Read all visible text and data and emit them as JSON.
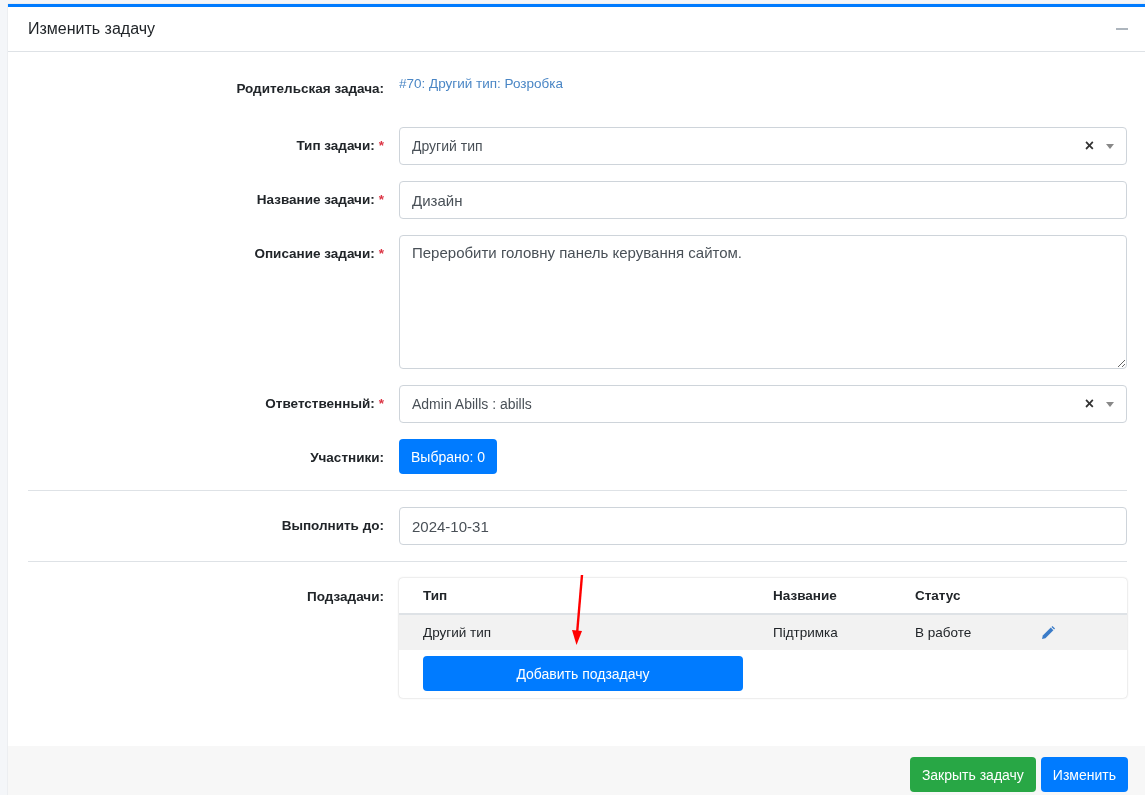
{
  "card": {
    "title": "Изменить задачу"
  },
  "form": {
    "parent": {
      "label": "Родительская задача:",
      "link": "#70: Другий тип: Розробка"
    },
    "fields": [
      {
        "kind": "select",
        "label": "Тип задачи:",
        "required_mark": "*",
        "value": "Другий тип",
        "clear": "×"
      },
      {
        "kind": "text",
        "label": "Название задачи:",
        "required_mark": "*",
        "value": "Дизайн"
      },
      {
        "kind": "textarea",
        "label": "Описание задачи:",
        "required_mark": "*",
        "value": "Переробити головну панель керування сайтом."
      },
      {
        "kind": "select",
        "label": "Ответственный:",
        "required_mark": "*",
        "value": "Admin Abills : abills",
        "clear": "×"
      },
      {
        "kind": "button",
        "label": "Участники:",
        "value": "Выбрано: 0"
      },
      {
        "kind": "divider"
      },
      {
        "kind": "text",
        "label": "Выполнить до:",
        "value": "2024-10-31"
      },
      {
        "kind": "divider"
      }
    ],
    "subtasks": {
      "label": "Подзадачи:",
      "columns": [
        "Тип",
        "Название",
        "Статус"
      ],
      "rows": [
        {
          "type": "Другий тип",
          "name": "Підтримка",
          "status": "В работе"
        }
      ],
      "add_button": "Добавить подзадачу"
    }
  },
  "footer": {
    "buttons": [
      {
        "label": "Закрыть задачу",
        "kind": "success"
      },
      {
        "label": "Изменить",
        "kind": "primary"
      }
    ]
  }
}
